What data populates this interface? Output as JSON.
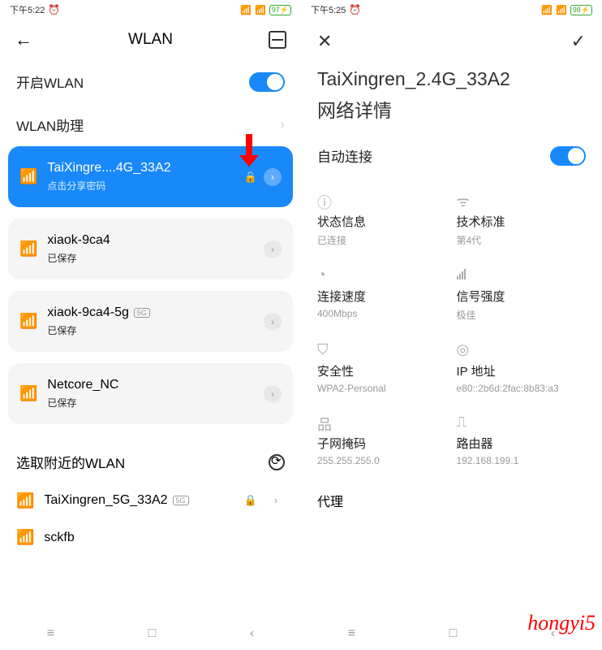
{
  "left": {
    "status_time": "下午5:22",
    "battery": "97",
    "header_title": "WLAN",
    "wlan_enable_label": "开启WLAN",
    "wlan_assistant_label": "WLAN助理",
    "networks": [
      {
        "name": "TaiXingre....4G_33A2",
        "subtitle": "点击分享密码",
        "locked": true,
        "active": true
      },
      {
        "name": "xiaok-9ca4",
        "subtitle": "已保存",
        "locked": false,
        "active": false
      },
      {
        "name": "xiaok-9ca4-5g",
        "subtitle": "已保存",
        "badge": "5G",
        "active": false
      },
      {
        "name": "Netcore_NC",
        "subtitle": "已保存",
        "active": false
      }
    ],
    "nearby_title": "选取附近的WLAN",
    "nearby": [
      {
        "name": "TaiXingren_5G_33A2",
        "badge": "5G",
        "locked": true
      },
      {
        "name": "sckfb"
      }
    ]
  },
  "right": {
    "status_time": "下午5:25",
    "battery": "98",
    "title": "TaiXingren_2.4G_33A2",
    "subtitle": "网络详情",
    "auto_connect_label": "自动连接",
    "info": {
      "status": {
        "label": "状态信息",
        "value": "已连接"
      },
      "tech": {
        "label": "技术标准",
        "value": "第4代"
      },
      "speed": {
        "label": "连接速度",
        "value": "400Mbps"
      },
      "signal": {
        "label": "信号强度",
        "value": "极佳"
      },
      "security": {
        "label": "安全性",
        "value": "WPA2-Personal"
      },
      "ip": {
        "label": "IP 地址",
        "value": "e80::2b6d:2fac:8b83:a3"
      },
      "subnet": {
        "label": "子网掩码",
        "value": "255.255.255.0"
      },
      "router": {
        "label": "路由器",
        "value": "192.168.199.1"
      }
    },
    "proxy_label": "代理"
  },
  "watermark": "hongyi5"
}
